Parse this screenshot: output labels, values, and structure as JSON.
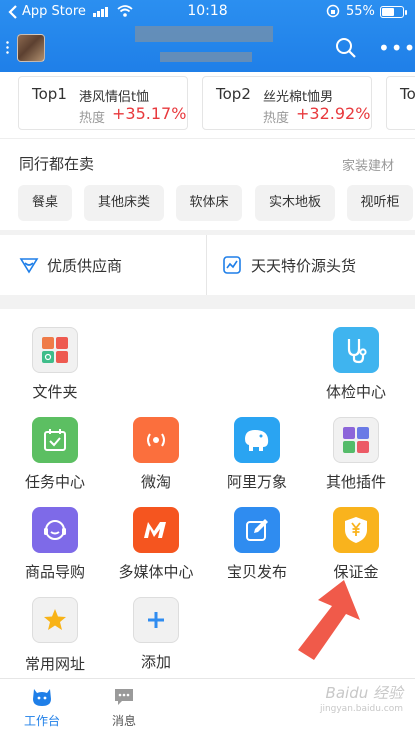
{
  "status_bar": {
    "back_app": "App Store",
    "time": "10:18",
    "battery": "55%"
  },
  "top_trending": [
    {
      "rank": "Top1",
      "name": "港风情侣t恤",
      "heat_label": "热度",
      "value": "+35.17%"
    },
    {
      "rank": "Top2",
      "name": "丝光棉t恤男",
      "heat_label": "热度",
      "value": "+32.92%"
    },
    {
      "rank": "To",
      "name": "",
      "heat_label": "",
      "value": ""
    }
  ],
  "peers": {
    "title": "同行都在卖",
    "category": "家装建材",
    "chips": [
      "餐桌",
      "其他床类",
      "软体床",
      "实木地板",
      "视听柜"
    ]
  },
  "suppliers": {
    "left_label": "优质供应商",
    "right_label": "天天特价源头货"
  },
  "apps": [
    {
      "label": "文件夹",
      "icon": "folder-grid-icon"
    },
    {
      "label": "体检中心",
      "icon": "stethoscope-icon"
    },
    {
      "label": "任务中心",
      "icon": "calendar-check-icon"
    },
    {
      "label": "微淘",
      "icon": "broadcast-icon"
    },
    {
      "label": "阿里万象",
      "icon": "elephant-icon"
    },
    {
      "label": "其他插件",
      "icon": "plugins-grid-icon"
    },
    {
      "label": "商品导购",
      "icon": "headset-icon"
    },
    {
      "label": "多媒体中心",
      "icon": "multimedia-m-icon"
    },
    {
      "label": "宝贝发布",
      "icon": "edit-icon"
    },
    {
      "label": "保证金",
      "icon": "yen-shield-icon"
    },
    {
      "label": "常用网址",
      "icon": "star-icon"
    },
    {
      "label": "添加",
      "icon": "plus-icon"
    }
  ],
  "tabbar": {
    "tabs": [
      {
        "label": "工作台",
        "icon": "workbench-icon",
        "active": true
      },
      {
        "label": "消息",
        "icon": "message-icon",
        "active": false
      }
    ]
  },
  "colors": {
    "brand_blue": "#1f7fe8",
    "heat_red": "#e8393d",
    "arrow_red": "#f05a4a"
  }
}
